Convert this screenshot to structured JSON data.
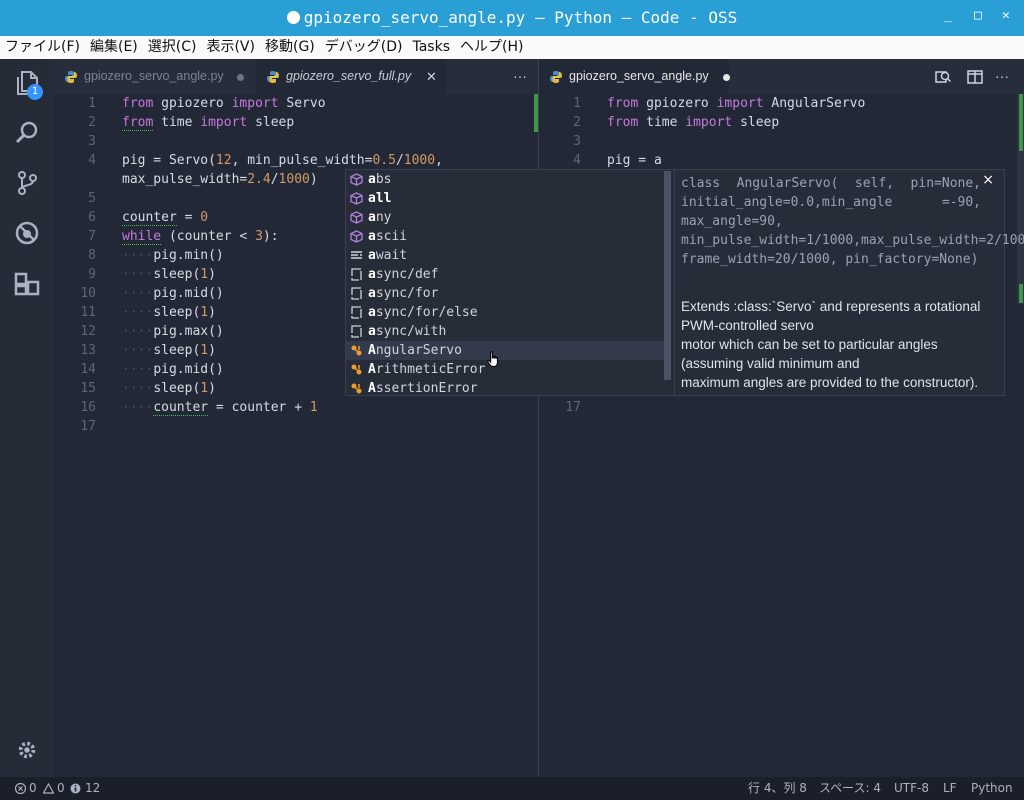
{
  "window": {
    "title": "gpiozero_servo_angle.py — Python — Code - OSS",
    "controls": [
      "_",
      "□",
      "✕"
    ]
  },
  "menu": [
    "ファイル(F)",
    "編集(E)",
    "選択(C)",
    "表示(V)",
    "移動(G)",
    "デバッグ(D)",
    "Tasks",
    "ヘルプ(H)"
  ],
  "activity": {
    "badge": "1"
  },
  "left": {
    "tabs": [
      {
        "label": "gpiozero_servo_angle.py"
      },
      {
        "label": "gpiozero_servo_full.py",
        "close": "✕"
      }
    ],
    "more": "···",
    "line_numbers": [
      "1",
      "2",
      "3",
      "4",
      "",
      "5",
      "6",
      "7",
      "8",
      "9",
      "10",
      "11",
      "12",
      "13",
      "14",
      "15",
      "16",
      "17"
    ]
  },
  "right": {
    "tab": {
      "label": "gpiozero_servo_angle.py"
    },
    "line_numbers": [
      "1",
      "2",
      "3",
      "4"
    ],
    "last_line_number": "17"
  },
  "code": {
    "l1": [
      "from",
      " gpiozero ",
      "import",
      " Servo"
    ],
    "l2": [
      "from",
      " time ",
      "import",
      " sleep"
    ],
    "l4": [
      "pig = Servo(",
      "12",
      ", min_pulse_width=",
      "0.5",
      "/",
      "1000",
      ","
    ],
    "l4b": [
      "max_pulse_width=",
      "2.4",
      "/",
      "1000",
      ")"
    ],
    "l6": [
      "counter",
      " = ",
      "0"
    ],
    "l7": [
      "while",
      " (counter < ",
      "3",
      "):"
    ],
    "loop": [
      {
        "call": "pig.min()"
      },
      {
        "fn": "sleep(",
        "n": "1",
        "close": ")"
      },
      {
        "call": "pig.mid()"
      },
      {
        "fn": "sleep(",
        "n": "1",
        "close": ")"
      },
      {
        "call": "pig.max()"
      },
      {
        "fn": "sleep(",
        "n": "1",
        "close": ")"
      },
      {
        "call": "pig.mid()"
      },
      {
        "fn": "sleep(",
        "n": "1",
        "close": ")"
      }
    ],
    "l16": [
      "counter",
      " = counter + ",
      "1"
    ],
    "indent": "····",
    "r1": [
      "from",
      " gpiozero ",
      "import",
      " AngularServo"
    ],
    "r2": [
      "from",
      " time ",
      "import",
      " sleep"
    ],
    "r4": "pig = a"
  },
  "suggest": {
    "items": [
      {
        "m": "a",
        "r": "bs",
        "k": "cube"
      },
      {
        "m": "a",
        "r": "ll",
        "k": "cube"
      },
      {
        "m": "a",
        "r": "ny",
        "k": "cube"
      },
      {
        "m": "a",
        "r": "scii",
        "k": "cube"
      },
      {
        "m": "a",
        "r": "wait",
        "k": "keyword"
      },
      {
        "m": "a",
        "r": "sync/def",
        "k": "snippet"
      },
      {
        "m": "a",
        "r": "sync/for",
        "k": "snippet"
      },
      {
        "m": "a",
        "r": "sync/for/else",
        "k": "snippet"
      },
      {
        "m": "a",
        "r": "sync/with",
        "k": "snippet"
      },
      {
        "m": "A",
        "r": "ngularServo",
        "k": "class"
      },
      {
        "m": "A",
        "r": "rithmeticError",
        "k": "class"
      },
      {
        "m": "A",
        "r": "ssertionError",
        "k": "class"
      }
    ],
    "selected": 9
  },
  "doc": {
    "signature": "class AngularServo( self, pin=None, initial_angle=0.0,min_angle =-90, max_angle=90, min_pulse_width=1/1000,max_pulse_width=2/1000, frame_width=20/1000, pin_factory=None)",
    "description": [
      "Extends :class:`Servo` and represents a rotational",
      "PWM-controlled servo",
      "motor which can be set to particular angles",
      "(assuming valid minimum and",
      "maximum angles are provided to the constructor)."
    ],
    "close": "×"
  },
  "status": {
    "errors": "0",
    "warnings": "0",
    "infos": "12",
    "position": "行 4、列 8",
    "spaces": "スペース: 4",
    "encoding": "UTF-8",
    "eol": "LF",
    "language": "Python"
  },
  "colors": {
    "titlebar": "#2a9fd6",
    "keyword": "#c678dd",
    "number": "#d19a66",
    "editor": "#232836"
  }
}
